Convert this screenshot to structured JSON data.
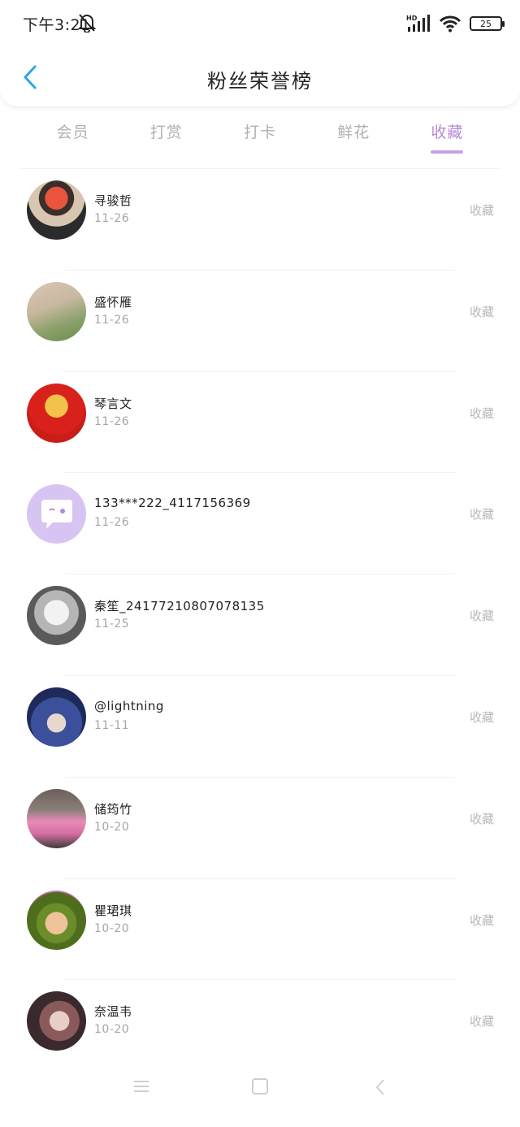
{
  "status_bar": {
    "time": "下午3:21",
    "battery": "25",
    "network": "HD"
  },
  "header": {
    "title": "粉丝荣誉榜"
  },
  "tabs": [
    {
      "label": "会员",
      "active": false
    },
    {
      "label": "打赏",
      "active": false
    },
    {
      "label": "打卡",
      "active": false
    },
    {
      "label": "鲜花",
      "active": false
    },
    {
      "label": "收藏",
      "active": true
    }
  ],
  "list": {
    "action_label": "收藏",
    "items": [
      {
        "name": "寻骏哲",
        "date": "11-26"
      },
      {
        "name": "盛怀雁",
        "date": "11-26"
      },
      {
        "name": "琴言文",
        "date": "11-26"
      },
      {
        "name": "133***222_4117156369",
        "date": "11-26"
      },
      {
        "name": "秦笙_24177210807078135",
        "date": "11-25"
      },
      {
        "name": "@lightning",
        "date": "11-11"
      },
      {
        "name": "储筠竹",
        "date": "10-20"
      },
      {
        "name": "瞿珺琪",
        "date": "10-20"
      },
      {
        "name": "奈温韦",
        "date": "10-20"
      }
    ]
  },
  "colors": {
    "accent": "#b48ad6",
    "accent_bar": "#c7a3e3",
    "back_arrow": "#2aa7e8",
    "text_muted": "#b0b0b0"
  }
}
